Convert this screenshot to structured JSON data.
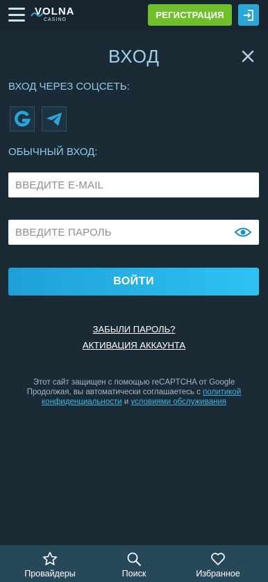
{
  "header": {
    "logo_main": "VOLNA",
    "logo_sub": "CASINO",
    "register_label": "РЕГИСТРАЦИЯ"
  },
  "dialog": {
    "title": "ВХОД",
    "social_label": "ВХОД ЧЕРЕЗ СОЦСЕТЬ:",
    "regular_label": "ОБЫЧНЫЙ ВХОД:",
    "email_placeholder": "ВВЕДИТЕ E-MAIL",
    "password_placeholder": "ВВЕДИТЕ ПАРОЛЬ",
    "submit_label": "ВОЙТИ",
    "forgot_link": "ЗАБЫЛИ ПАРОЛЬ?",
    "activate_link": "АКТИВАЦИЯ АККАУНТА"
  },
  "recaptcha": {
    "line1": "Этот сайт защищен с помощью reCAPTCHA от Google",
    "line2_prefix": "Продолжая, вы автоматически соглашаетесь с ",
    "privacy_link": "политикой конфиденциальности",
    "and_text": " и ",
    "terms_link": "условиями обслуживания"
  },
  "bottom_nav": {
    "items": [
      {
        "label": "Провайдеры",
        "icon": "star-icon"
      },
      {
        "label": "Поиск",
        "icon": "search-icon"
      },
      {
        "label": "Избранное",
        "icon": "heart-icon"
      }
    ]
  },
  "colors": {
    "background": "#1b2b36",
    "accent_blue": "#2cc3f3",
    "register_green": "#6fbf2a",
    "bottom_bar": "#264858"
  }
}
